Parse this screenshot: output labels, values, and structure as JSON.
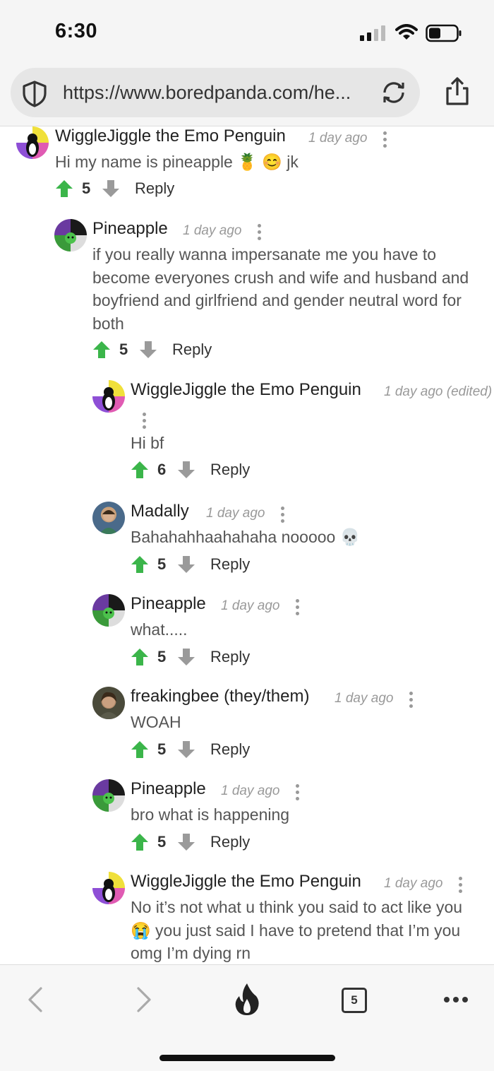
{
  "status_bar": {
    "time": "6:30"
  },
  "browser": {
    "url": "https://www.boredpanda.com/he...",
    "tab_count": "5"
  },
  "comments": [
    {
      "user": "WiggleJiggle the Emo Penguin",
      "time": "1 day ago",
      "text": "Hi my name is pineapple 🍍 😊 jk",
      "score": "5",
      "reply": "Reply"
    },
    {
      "user": "Pineapple",
      "time": "1 day ago",
      "text": "if you really wanna impersanate me you have to become everyones crush and wife and husband and boyfriend and girlfriend and gender neutral word for both",
      "score": "5",
      "reply": "Reply"
    },
    {
      "user": "WiggleJiggle the Emo Penguin",
      "time": "1 day ago (edited)",
      "text": "Hi bf",
      "score": "6",
      "reply": "Reply"
    },
    {
      "user": "Madally",
      "time": "1 day ago",
      "text": "Bahahahhaahahaha nooooo 💀",
      "score": "5",
      "reply": "Reply"
    },
    {
      "user": "Pineapple",
      "time": "1 day ago",
      "text": "what.....",
      "score": "5",
      "reply": "Reply"
    },
    {
      "user": "freakingbee (they/them)",
      "time": "1 day ago",
      "text": "WOAH",
      "score": "5",
      "reply": "Reply"
    },
    {
      "user": "Pineapple",
      "time": "1 day ago",
      "text": "bro what is happening",
      "score": "5",
      "reply": "Reply"
    },
    {
      "user": "WiggleJiggle the Emo Penguin",
      "time": "1 day ago",
      "text": "No it’s not what u think you said to act like you 😭 you just said I have to pretend that I’m you omg I’m dying rn",
      "score": "",
      "reply": ""
    }
  ],
  "colors": {
    "upvote": "#3bb54a",
    "downvote": "#9a9a9a",
    "meta": "#999999"
  }
}
